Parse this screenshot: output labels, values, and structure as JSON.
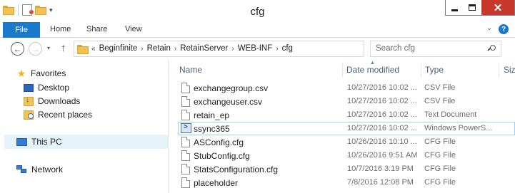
{
  "window": {
    "title": "cfg",
    "close_glyph": "✕"
  },
  "ribbon": {
    "file_tab": "File",
    "tabs": [
      "Home",
      "Share",
      "View"
    ],
    "help_glyph": "?"
  },
  "navigation": {
    "back_glyph": "←",
    "forward_glyph": "→",
    "up_glyph": "↑",
    "overflow": "«",
    "breadcrumb": [
      "Beginfinite",
      "Retain",
      "RetainServer",
      "WEB-INF",
      "cfg"
    ],
    "search_placeholder": "Search cfg"
  },
  "nav_pane": {
    "favorites": "Favorites",
    "desktop": "Desktop",
    "downloads": "Downloads",
    "recent_places": "Recent places",
    "this_pc": "This PC",
    "network": "Network"
  },
  "columns": {
    "name": "Name",
    "date_modified": "Date modified",
    "type": "Type",
    "size": "Siz"
  },
  "files": [
    {
      "name": "exchangegroup.csv",
      "date": "10/27/2016 10:02 ...",
      "type": "CSV File",
      "icon": "document-icon"
    },
    {
      "name": "exchangeuser.csv",
      "date": "10/27/2016 10:02 ...",
      "type": "CSV File",
      "icon": "document-icon"
    },
    {
      "name": "retain_ep",
      "date": "10/27/2016 10:02 ...",
      "type": "Text Document",
      "icon": "document-icon"
    },
    {
      "name": "ssync365",
      "date": "10/27/2016 10:02 ...",
      "type": "Windows PowerS...",
      "icon": "powershell-script-icon"
    },
    {
      "name": "ASConfig.cfg",
      "date": "10/26/2016 10:10 ...",
      "type": "CFG File",
      "icon": "document-icon"
    },
    {
      "name": "StubConfig.cfg",
      "date": "10/26/2016 9:51 AM",
      "type": "CFG File",
      "icon": "document-icon"
    },
    {
      "name": "StatsConfiguration.cfg",
      "date": "10/7/2016 3:19 PM",
      "type": "CFG File",
      "icon": "document-icon"
    },
    {
      "name": "placeholder",
      "date": "7/8/2016 12:08 PM",
      "type": "CFG File",
      "icon": "document-icon"
    }
  ],
  "colors": {
    "file_tab": "#1979ca",
    "close_button": "#c7372b",
    "selection_border": "#99d1ff",
    "header_text": "#4c607a"
  }
}
